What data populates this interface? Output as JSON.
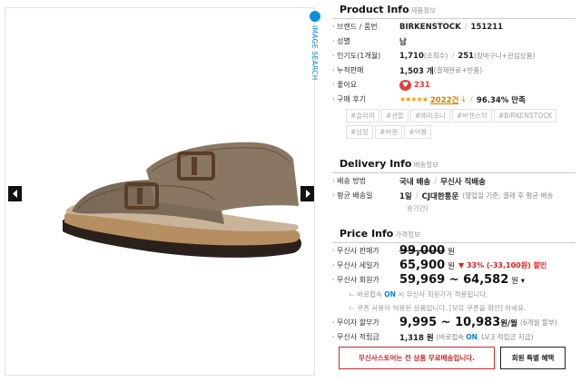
{
  "gallery": {
    "image_search_label": "IMAGE SEARCH",
    "prev_icon": "chevron-left-icon",
    "next_icon": "chevron-right-icon"
  },
  "product_info": {
    "title": "Product Info",
    "subtitle": "제품정보",
    "brand_label": "· 브랜드 / 품번",
    "brand": "BIRKENSTOCK",
    "brand_sep": "/",
    "product_no": "151211",
    "gender_label": "· 성별",
    "gender": "남",
    "popularity_label": "· 인기도(1개월)",
    "views": "1,710",
    "views_note": "(조회수)",
    "pop_sep": "/",
    "cart": "251",
    "cart_note": "(장바구니+관심상품)",
    "sales_label": "· 누적판매",
    "sales": "1,503 개",
    "sales_note": "(결제완료+반품)",
    "likes_label": "· 좋아요",
    "likes": "231",
    "review_label": "· 구매 후기",
    "stars": "★★★★★",
    "review_count": "2022건",
    "review_arrow": "↓",
    "review_sep": "/",
    "satisfaction": "96.34% 만족",
    "tags": [
      "#슬리퍼",
      "#샌들",
      "#애리조나",
      "#버켄스탁",
      "#BIRKENSTOCK",
      "#남성",
      "#버켄",
      "#여름"
    ]
  },
  "delivery_info": {
    "title": "Delivery Info",
    "subtitle": "배송정보",
    "method_label": "· 배송 방법",
    "method": "국내 배송",
    "method_sep": "/",
    "method2": "무신사 직배송",
    "avg_label": "· 평균 배송일",
    "avg_days": "1일",
    "avg_sep": "/",
    "courier": "CJ대한통운",
    "avg_note_1": "(영업일 기준, 결제 후 평균 배송",
    "avg_note_2": "송기간)"
  },
  "price_info": {
    "title": "Price Info",
    "subtitle": "가격정보",
    "sale_label": "· 무신사 판매가",
    "sale_price": "99,000",
    "won": "원",
    "member_sale_label": "· 무신사 세일가",
    "member_sale_price": "65,900",
    "discount": "▼ 33% (-33,100원) 할인",
    "member_label": "· 무신사 회원가",
    "member_price": "59,969 ~ 64,582",
    "member_unit": "원 ▾",
    "note1_prefix": "ㄴ 바로접속",
    "note1_on": "ON",
    "note1_suffix": "시 무신사 회원가가 적용됩니다.",
    "note2": "ㄴ 쿠폰 사용이 허용된 상품입니다. [보유 쿠폰을 확인] 하세요.",
    "installment_label": "· 무이자 할부가",
    "installment_price": "9,995 ~ 10,983",
    "installment_unit": "원/월",
    "installment_note": "(6개월 할부)",
    "points_label": "· 무신사 적립금",
    "points": "1,318 원",
    "points_note_prefix": "(바로접속",
    "points_on": "ON",
    "points_note_suffix": ", LV.3 적립금 지급)"
  },
  "buttons": {
    "free_shipping": "무신사스토어는 전 상품 무료배송입니다.",
    "member_benefit": "회원 특별 혜택"
  }
}
